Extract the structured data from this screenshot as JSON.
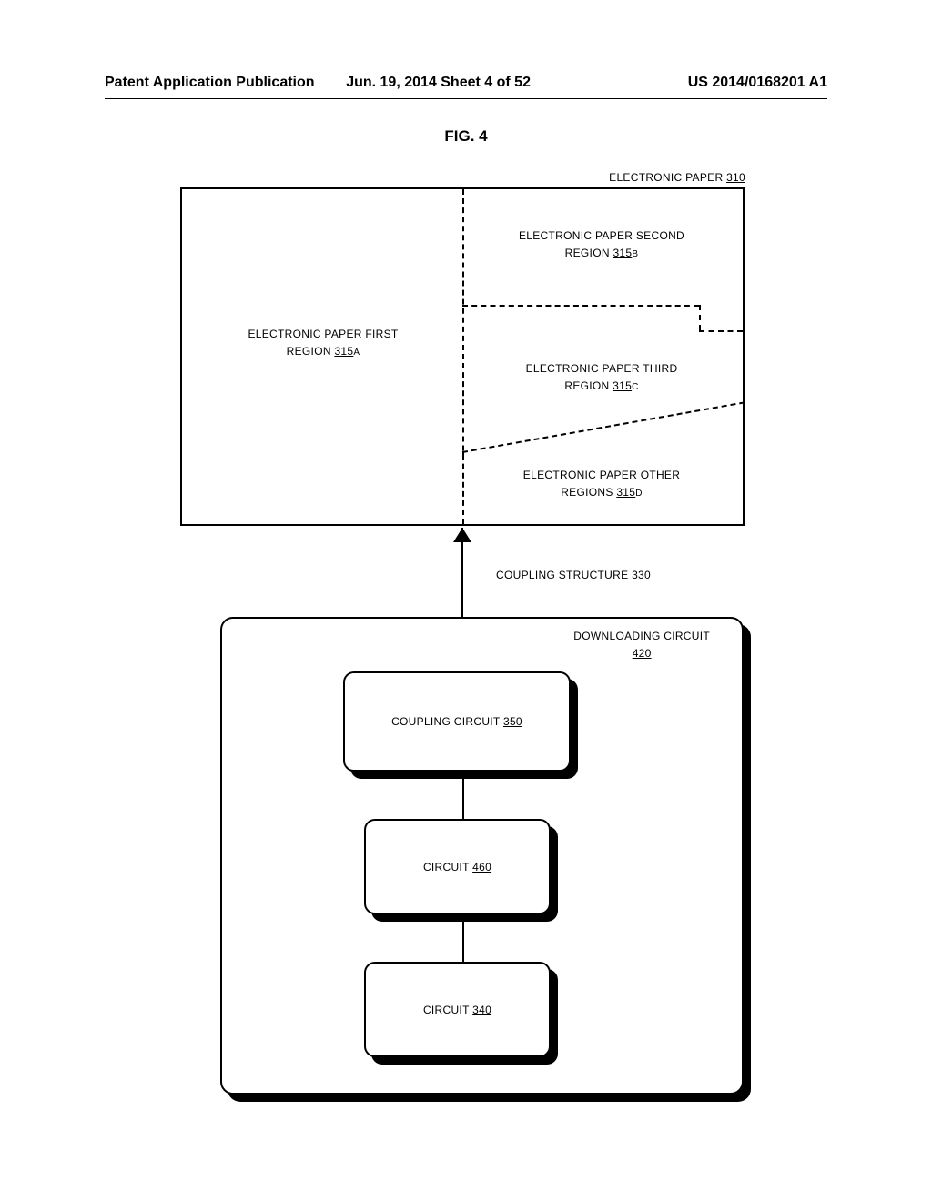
{
  "header": {
    "left": "Patent Application Publication",
    "mid": "Jun. 19, 2014  Sheet 4 of 52",
    "right": "US 2014/0168201 A1"
  },
  "figure_label": "FIG. 4",
  "labels": {
    "electronic_paper": {
      "text": "ELECTRONIC PAPER",
      "num": "310"
    },
    "first_region": {
      "line1": "ELECTRONIC PAPER FIRST",
      "line2": "REGION",
      "num": "315",
      "sub": "A"
    },
    "second_region": {
      "line1": "ELECTRONIC PAPER SECOND",
      "line2": "REGION",
      "num": "315",
      "sub": "B"
    },
    "third_region": {
      "line1": "ELECTRONIC PAPER THIRD",
      "line2": "REGION",
      "num": "315",
      "sub": "C"
    },
    "other_regions": {
      "line1": "ELECTRONIC PAPER OTHER",
      "line2": "REGIONS",
      "num": "315",
      "sub": "D"
    },
    "coupling_structure": {
      "text": "COUPLING STRUCTURE",
      "num": "330"
    },
    "downloading_circuit": {
      "text": "DOWNLOADING CIRCUIT",
      "num": "420"
    },
    "coupling_circuit": {
      "text": "COUPLING CIRCUIT",
      "num": "350"
    },
    "circuit_460": {
      "text": "CIRCUIT",
      "num": "460"
    },
    "circuit_340": {
      "text": "CIRCUIT",
      "num": "340"
    }
  }
}
